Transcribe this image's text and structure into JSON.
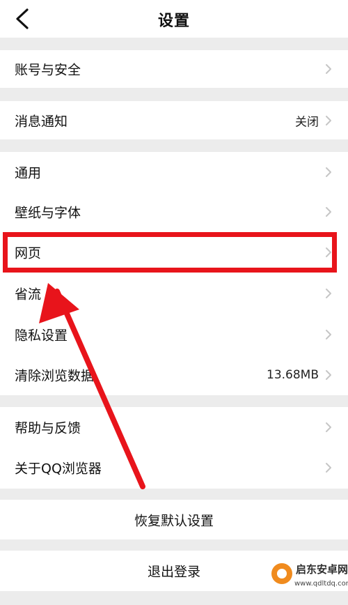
{
  "header": {
    "title": "设置",
    "back_icon": "chevron-left-icon"
  },
  "settings": {
    "account_security": "账号与安全",
    "notifications": "消息通知",
    "notifications_value": "关闭",
    "general": "通用",
    "wallpaper_font": "壁纸与字体",
    "web_page": "网页",
    "data_saving": "省流",
    "privacy": "隐私设置",
    "clear_data": "清除浏览数据",
    "clear_data_value": "13.68MB",
    "help_feedback": "帮助与反馈",
    "about": "关于QQ浏览器",
    "restore_defaults": "恢复默认设置",
    "logout": "退出登录"
  },
  "watermark": {
    "title": "启东安卓网",
    "url": "www.qdltdq.com"
  },
  "colors": {
    "highlight": "#e8141b",
    "background": "#ececec",
    "row": "#ffffff",
    "chevron": "#c6c6c6"
  },
  "icons": {
    "row_chevron": "chevron-right-icon",
    "annotation": "red-arrow-icon"
  }
}
